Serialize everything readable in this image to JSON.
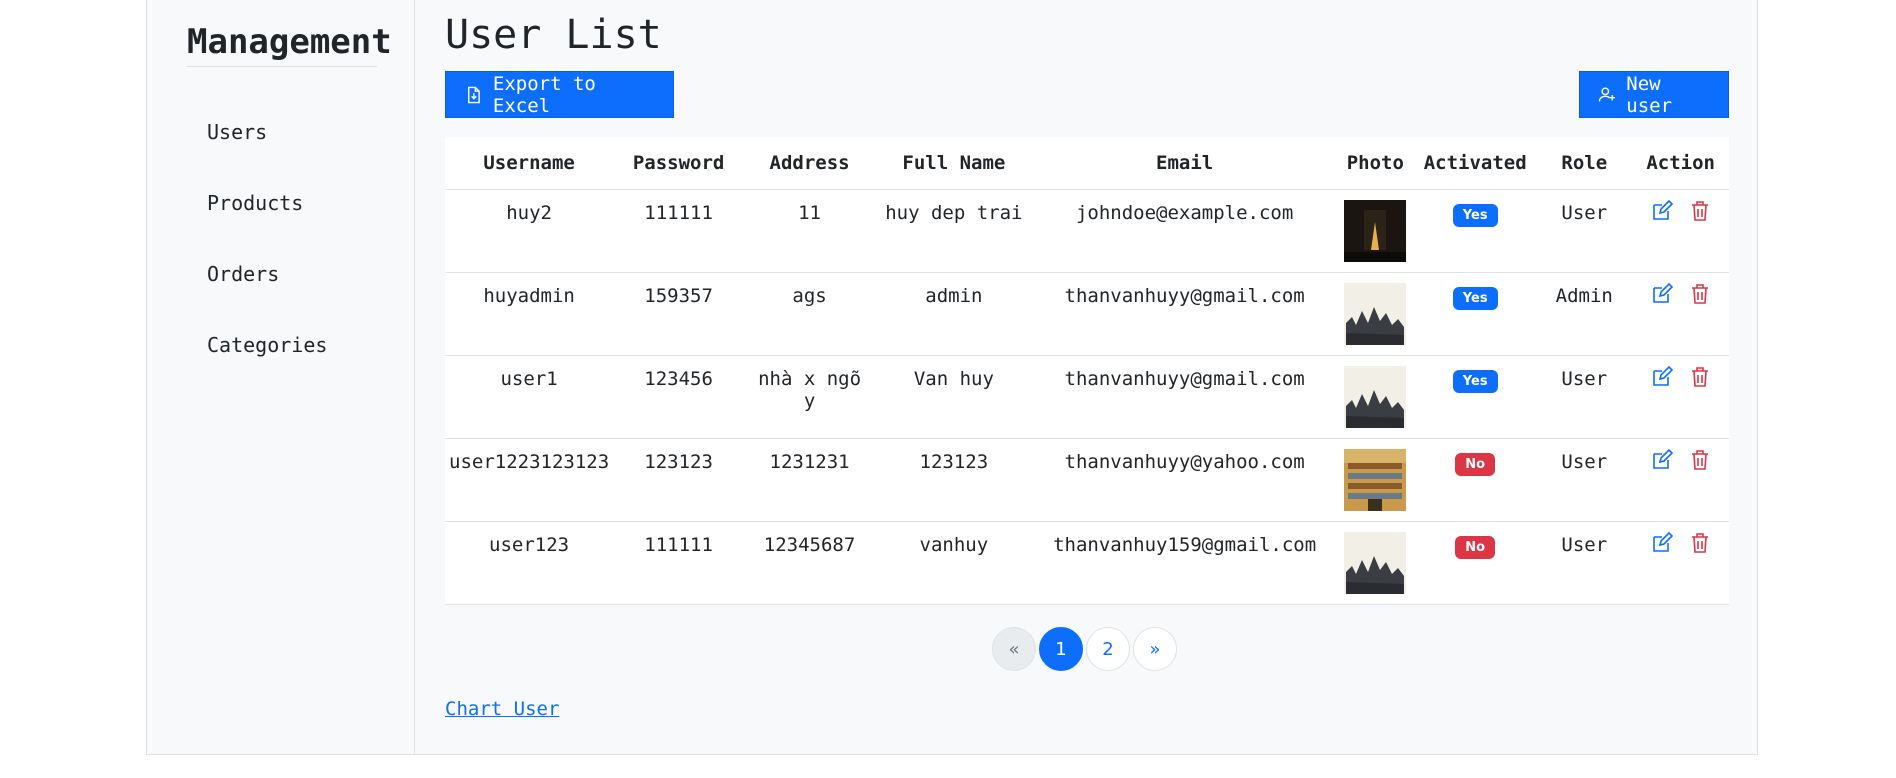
{
  "sidebar": {
    "brand": "Management",
    "items": [
      {
        "label": "Users"
      },
      {
        "label": "Products"
      },
      {
        "label": "Orders"
      },
      {
        "label": "Categories"
      }
    ]
  },
  "main": {
    "title": "User List",
    "export_label": "Export to Excel",
    "new_user_label": "New user",
    "chart_link": "Chart User"
  },
  "table": {
    "headers": [
      "Username",
      "Password",
      "Address",
      "Full Name",
      "Email",
      "Photo",
      "Activated",
      "Role",
      "Action"
    ],
    "rows": [
      {
        "username": "huy2",
        "password": "111111",
        "address": "11",
        "full_name": "huy dep trai",
        "email": "johndoe@example.com",
        "photo": "dark-lamp-photo",
        "activated": "Yes",
        "role": "User"
      },
      {
        "username": "huyadmin",
        "password": "159357",
        "address": "ags",
        "full_name": "admin",
        "email": "thanvanhuyy@gmail.com",
        "photo": "city-skyline-photo",
        "activated": "Yes",
        "role": "Admin"
      },
      {
        "username": "user1",
        "password": "123456",
        "address": "nhà x ngõ y",
        "full_name": "Van huy",
        "email": "thanvanhuyy@gmail.com",
        "photo": "city-skyline-photo",
        "activated": "Yes",
        "role": "User"
      },
      {
        "username": "user1223123123",
        "password": "123123",
        "address": "1231231",
        "full_name": "123123",
        "email": "thanvanhuyy@yahoo.com",
        "photo": "building-interior-photo",
        "activated": "No",
        "role": "User"
      },
      {
        "username": "user123",
        "password": "111111",
        "address": "12345687",
        "full_name": "vanhuy",
        "email": "thanvanhuy159@gmail.com",
        "photo": "city-skyline-photo",
        "activated": "No",
        "role": "User"
      }
    ]
  },
  "pagination": {
    "prev": "«",
    "pages": [
      "1",
      "2"
    ],
    "active_page": "1",
    "next": "»"
  },
  "colors": {
    "primary": "#0d6efd",
    "danger": "#dc3545"
  }
}
